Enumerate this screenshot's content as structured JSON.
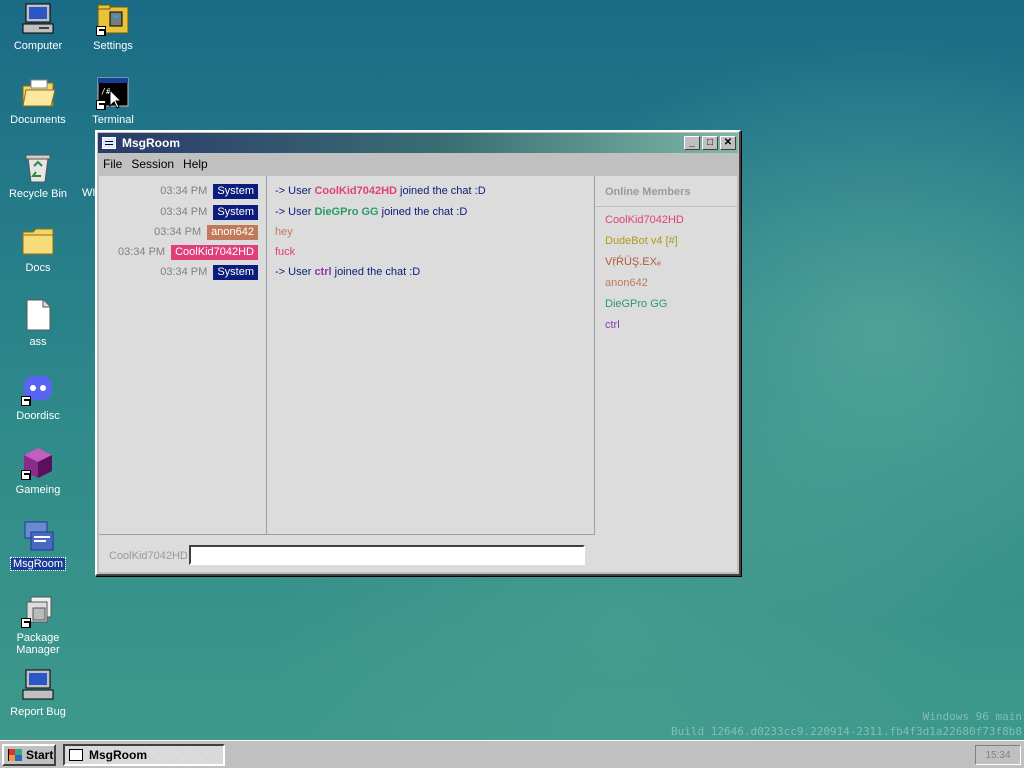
{
  "desktop": {
    "icons": [
      {
        "label": "Computer"
      },
      {
        "label": "Settings"
      },
      {
        "label": "Documents"
      },
      {
        "label": "Terminal"
      },
      {
        "label": "Recycle Bin"
      },
      {
        "label": "Docs"
      },
      {
        "label": "ass"
      },
      {
        "label": "Doordisc"
      },
      {
        "label": "Gameing"
      },
      {
        "label": "MsgRoom"
      },
      {
        "label": "Package Manager"
      },
      {
        "label": "Report Bug"
      }
    ],
    "partial_label": "WI",
    "watermark": {
      "line1": "Windows 96 main",
      "line2": "Build 12646.d0233cc9.220914-2311.fb4f3d1a22680f73f8b8"
    }
  },
  "window": {
    "title": "MsgRoom",
    "menu": [
      "File",
      "Session",
      "Help"
    ],
    "controls": {
      "minimize": "_",
      "maximize": "□",
      "close": "✕"
    },
    "log": [
      {
        "time": "03:34 PM",
        "user": "System",
        "user_color": "#0c1c7c"
      },
      {
        "time": "03:34 PM",
        "user": "System",
        "user_color": "#0c1c7c"
      },
      {
        "time": "03:34 PM",
        "user": "anon642",
        "user_color": "#c07a5a"
      },
      {
        "time": "03:34 PM",
        "user": "CoolKid7042HD",
        "user_color": "#e0407a"
      },
      {
        "time": "03:34 PM",
        "user": "System",
        "user_color": "#0c1c7c"
      }
    ],
    "messages": [
      {
        "prefix": "-> User ",
        "name": "CoolKid7042HD",
        "suffix": " joined the chat :D",
        "color": "#0c1c7c",
        "name_color": "#e0407a"
      },
      {
        "prefix": "-> User ",
        "name": "DieGPro GG",
        "suffix": " joined the chat :D",
        "color": "#0c1c7c",
        "name_color": "#2a9a6a"
      },
      {
        "prefix": "hey",
        "name": "",
        "suffix": "",
        "color": "#c07a5a",
        "name_color": "#c07a5a"
      },
      {
        "prefix": "fuck",
        "name": "",
        "suffix": "",
        "color": "#e0407a",
        "name_color": "#e0407a"
      },
      {
        "prefix": "-> User ",
        "name": "ctrl",
        "suffix": " joined the chat :D",
        "color": "#0c1c7c",
        "name_color": "#8a3ab0"
      }
    ],
    "members_header": "Online Members",
    "members": [
      {
        "name": "CoolKid7042HD",
        "color": "#e0407a"
      },
      {
        "name": "DudeBot v4 [#]",
        "color": "#b09a1a"
      },
      {
        "name": "VṝŔÜŞ.EXₑ",
        "color": "#b05a3a"
      },
      {
        "name": "anon642",
        "color": "#c07a5a"
      },
      {
        "name": "DieGPro GG",
        "color": "#2a9a6a"
      },
      {
        "name": "ctrl",
        "color": "#8a3ab0"
      }
    ],
    "input_label": "CoolKid7042HD",
    "input_value": ""
  },
  "taskbar": {
    "start_label": "Start",
    "task_label": "MsgRoom",
    "clock": "15:34"
  }
}
